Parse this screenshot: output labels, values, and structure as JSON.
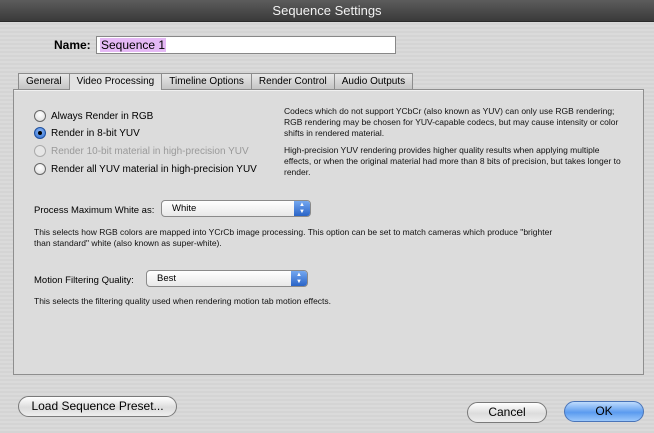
{
  "window": {
    "title": "Sequence Settings"
  },
  "name_field": {
    "label": "Name:",
    "value": "Sequence 1"
  },
  "tabs": [
    {
      "label": "General"
    },
    {
      "label": "Video Processing"
    },
    {
      "label": "Timeline Options"
    },
    {
      "label": "Render Control"
    },
    {
      "label": "Audio Outputs"
    }
  ],
  "render_options": [
    {
      "label": "Always Render in RGB"
    },
    {
      "label": "Render in 8-bit YUV"
    },
    {
      "label": "Render 10-bit material in high-precision YUV"
    },
    {
      "label": "Render all YUV material in high-precision YUV"
    }
  ],
  "descriptions": {
    "codecs": "Codecs which do not support YCbCr (also known as YUV) can only use RGB rendering; RGB rendering may be chosen for YUV-capable codecs, but may cause intensity or color shifts in rendered material.",
    "high_precision": "High-precision YUV rendering provides higher quality results when applying multiple effects, or when the original material had more than 8 bits of precision, but takes longer to render."
  },
  "max_white": {
    "label": "Process Maximum White as:",
    "value": "White",
    "description": "This selects how RGB colors are mapped into YCrCb image processing. This option can be set to match cameras which produce \"brighter than standard\" white (also known as super-white)."
  },
  "motion_filtering": {
    "label": "Motion Filtering Quality:",
    "value": "Best",
    "description": "This selects the filtering quality used when rendering motion tab motion effects."
  },
  "buttons": {
    "load_preset": "Load Sequence Preset...",
    "cancel": "Cancel",
    "ok": "OK"
  }
}
